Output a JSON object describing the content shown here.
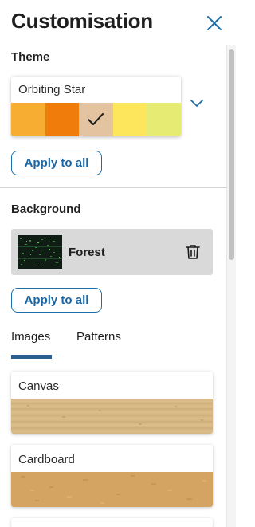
{
  "header": {
    "title": "Customisation"
  },
  "theme": {
    "section_label": "Theme",
    "selected_name": "Orbiting Star",
    "swatches": [
      "#f6ad32",
      "#ef7c0b",
      "#e4c3a0",
      "#fde65b",
      "#e6ec73"
    ],
    "selected_swatch_index": 2,
    "apply_label": "Apply to all"
  },
  "background": {
    "section_label": "Background",
    "current": {
      "name": "Forest"
    },
    "apply_label": "Apply to all",
    "tabs": [
      {
        "label": "Images",
        "active": true
      },
      {
        "label": "Patterns",
        "active": false
      }
    ],
    "images": [
      {
        "name": "Canvas",
        "color": "#d6b885"
      },
      {
        "name": "Cardboard",
        "color": "#d3a462"
      }
    ]
  },
  "colors": {
    "accent": "#1d6ea8",
    "tab_indicator": "#2a5f8f",
    "card_bg": "#d9d9d9"
  }
}
